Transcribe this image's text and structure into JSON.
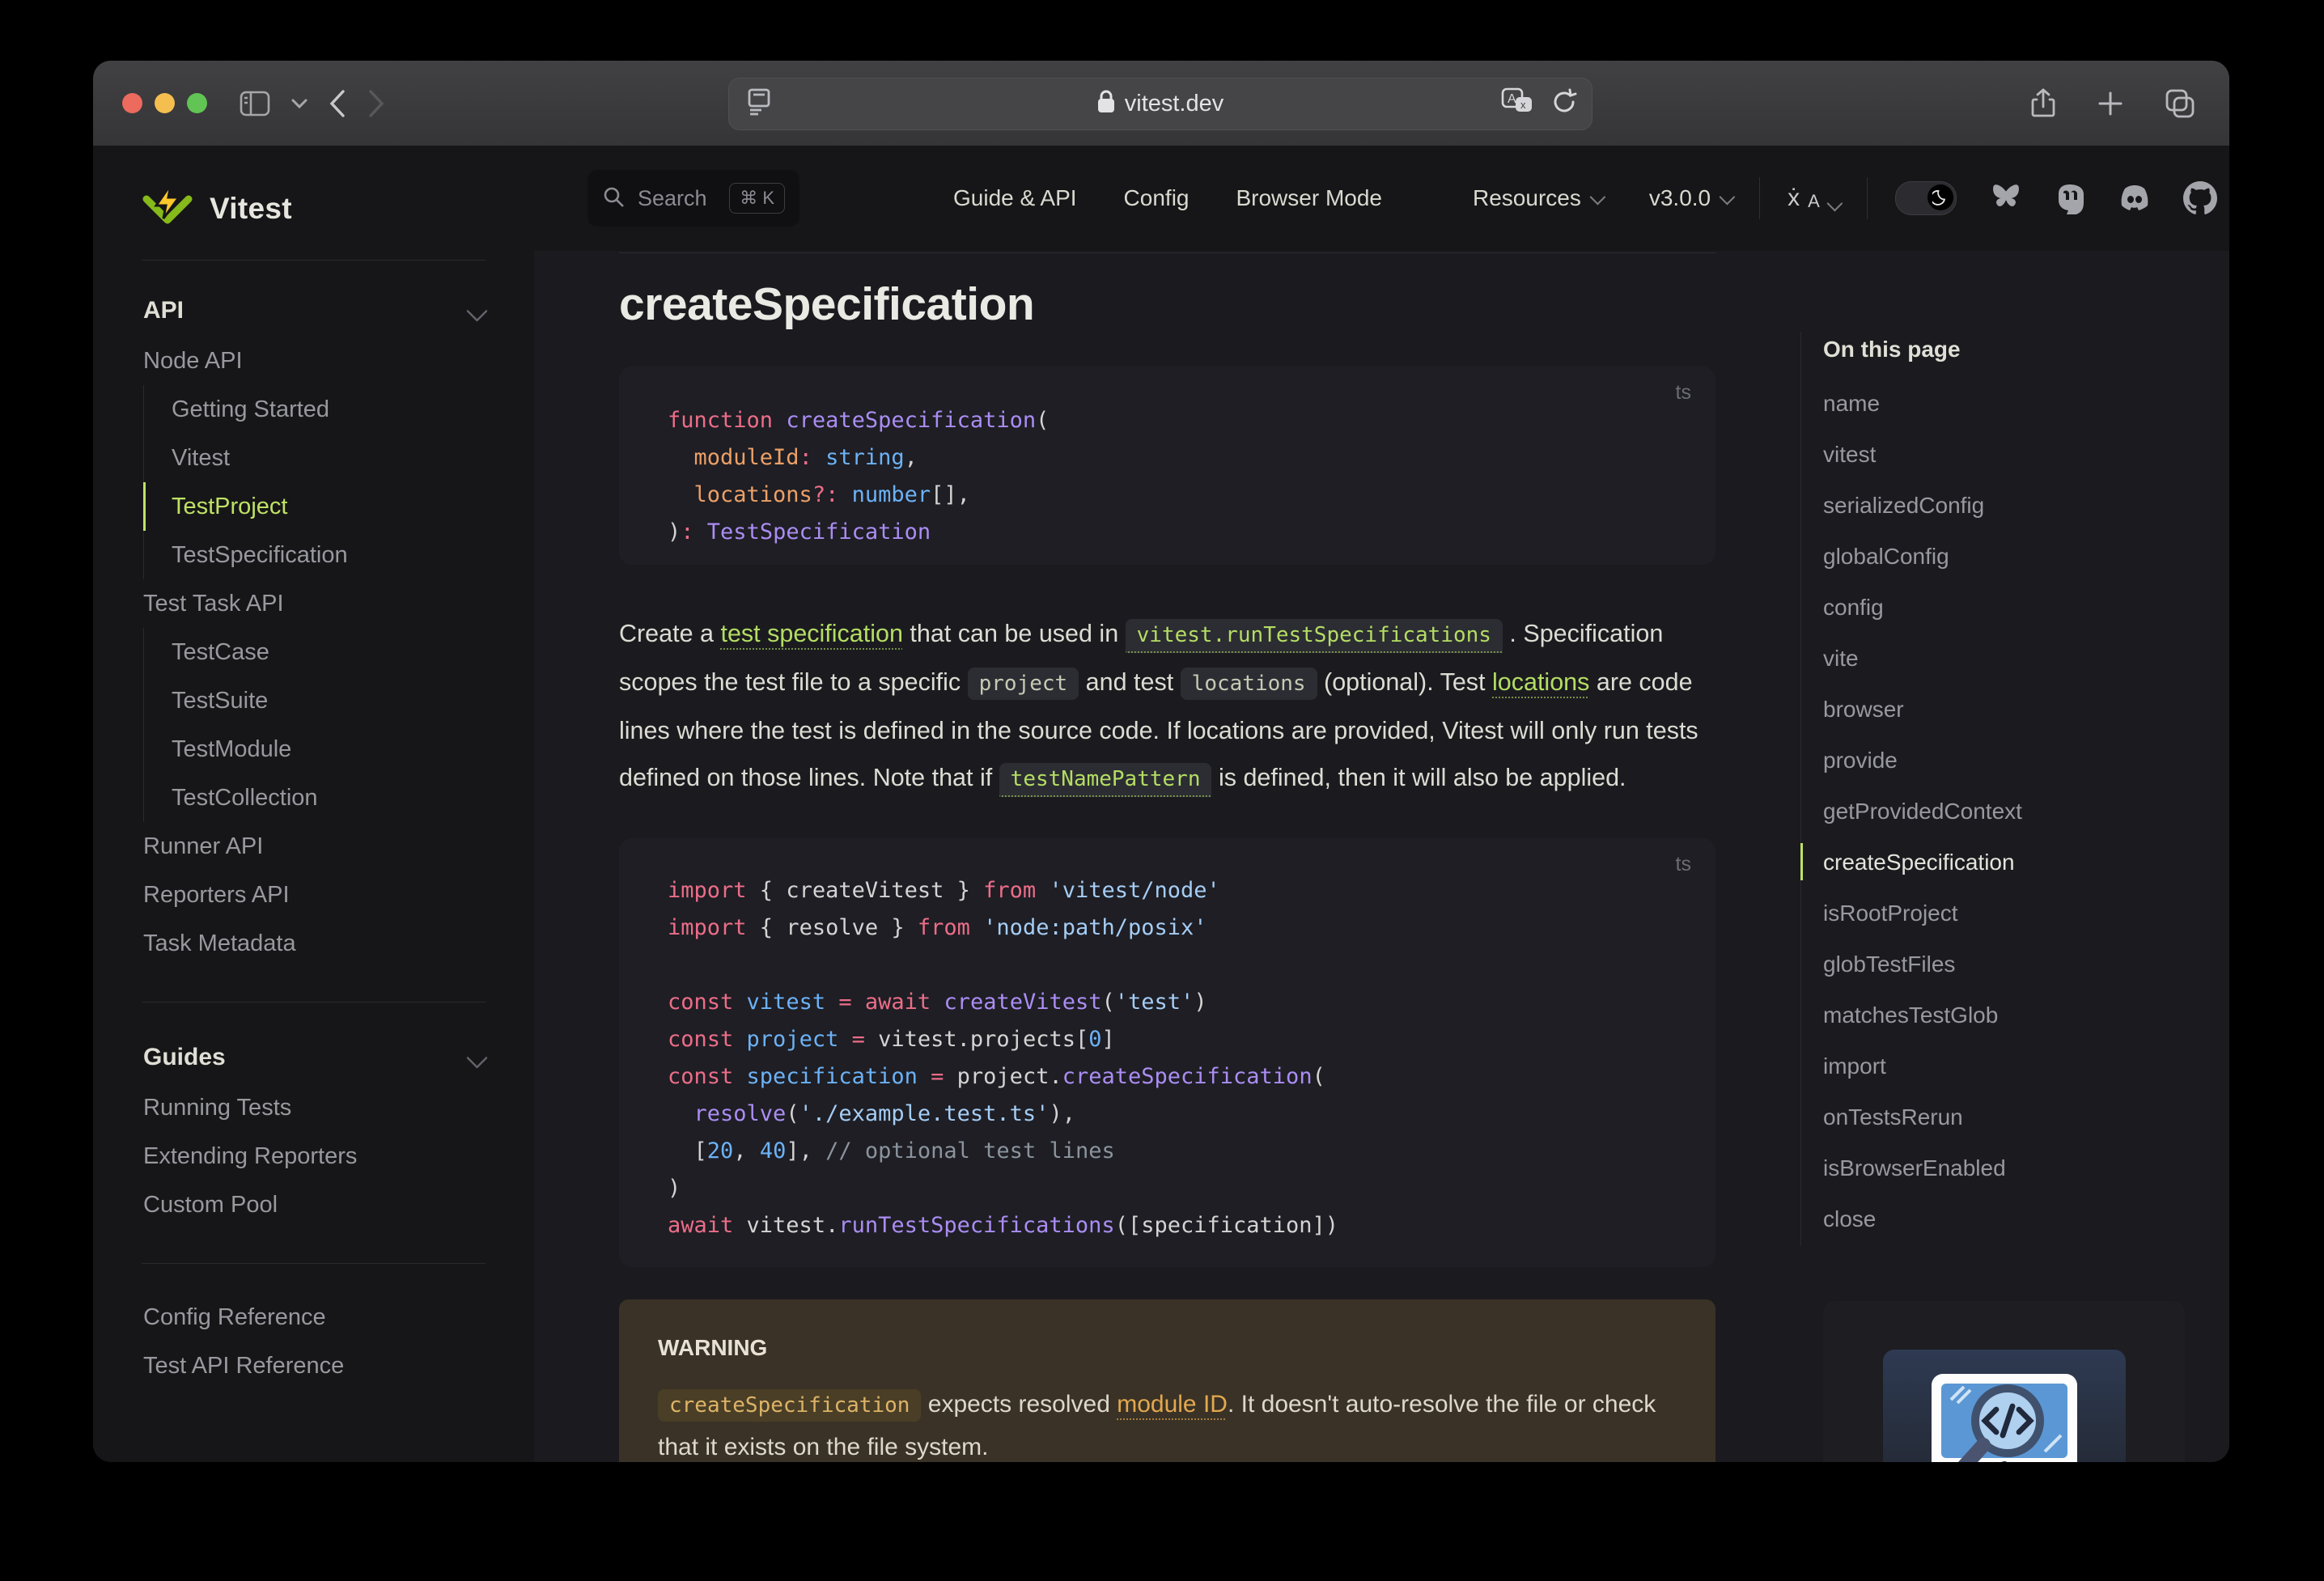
{
  "browser": {
    "url": "vitest.dev",
    "traffic_lights": [
      "#ec6a5e",
      "#f4bf4f",
      "#61c454"
    ]
  },
  "navbar": {
    "search": {
      "label": "Search",
      "shortcut": "⌘ K"
    },
    "links": [
      "Guide & API",
      "Config",
      "Browser Mode"
    ],
    "resources": "Resources",
    "version": "v3.0.0"
  },
  "sidebar": {
    "brand": "Vitest",
    "groups": [
      {
        "header": "API",
        "divider_above": false,
        "items": [
          {
            "label": "Node API",
            "indent": 0,
            "active": false
          },
          {
            "label": "Getting Started",
            "indent": 1,
            "active": false
          },
          {
            "label": "Vitest",
            "indent": 1,
            "active": false
          },
          {
            "label": "TestProject",
            "indent": 1,
            "active": true
          },
          {
            "label": "TestSpecification",
            "indent": 1,
            "active": false
          },
          {
            "label": "Test Task API",
            "indent": 0,
            "active": false
          },
          {
            "label": "TestCase",
            "indent": 1,
            "active": false
          },
          {
            "label": "TestSuite",
            "indent": 1,
            "active": false
          },
          {
            "label": "TestModule",
            "indent": 1,
            "active": false
          },
          {
            "label": "TestCollection",
            "indent": 1,
            "active": false
          },
          {
            "label": "Runner API",
            "indent": 0,
            "active": false
          },
          {
            "label": "Reporters API",
            "indent": 0,
            "active": false
          },
          {
            "label": "Task Metadata",
            "indent": 0,
            "active": false
          }
        ]
      },
      {
        "header": "Guides",
        "divider_above": true,
        "items": [
          {
            "label": "Running Tests",
            "indent": 0,
            "active": false
          },
          {
            "label": "Extending Reporters",
            "indent": 0,
            "active": false
          },
          {
            "label": "Custom Pool",
            "indent": 0,
            "active": false
          }
        ]
      },
      {
        "header": null,
        "divider_above": true,
        "items": [
          {
            "label": "Config Reference",
            "indent": 0,
            "active": false
          },
          {
            "label": "Test API Reference",
            "indent": 0,
            "active": false
          }
        ]
      }
    ]
  },
  "content": {
    "title": "createSpecification",
    "code_block_1": {
      "lang": "ts",
      "lines": [
        [
          {
            "c": "k",
            "t": "function "
          },
          {
            "c": "f",
            "t": "createSpecification"
          },
          {
            "c": "p",
            "t": "("
          }
        ],
        [
          {
            "c": "p",
            "t": "  "
          },
          {
            "c": "o",
            "t": "moduleId"
          },
          {
            "c": "k",
            "t": ":"
          },
          {
            "c": "p",
            "t": " "
          },
          {
            "c": "b",
            "t": "string"
          },
          {
            "c": "p",
            "t": ","
          }
        ],
        [
          {
            "c": "p",
            "t": "  "
          },
          {
            "c": "o",
            "t": "locations"
          },
          {
            "c": "k",
            "t": "?:"
          },
          {
            "c": "p",
            "t": " "
          },
          {
            "c": "b",
            "t": "number"
          },
          {
            "c": "p",
            "t": "[],"
          }
        ],
        [
          {
            "c": "p",
            "t": ")"
          },
          {
            "c": "k",
            "t": ":"
          },
          {
            "c": "p",
            "t": " "
          },
          {
            "c": "f",
            "t": "TestSpecification"
          }
        ]
      ]
    },
    "paragraph": [
      {
        "c": "text",
        "t": "Create a "
      },
      {
        "c": "link",
        "t": "test specification"
      },
      {
        "c": "text",
        "t": " that can be used in "
      },
      {
        "c": "codelink",
        "t": "vitest.runTestSpecifications"
      },
      {
        "c": "text",
        "t": " . Specification scopes the test file to a specific "
      },
      {
        "c": "code",
        "t": "project"
      },
      {
        "c": "text",
        "t": " and test "
      },
      {
        "c": "code",
        "t": "locations"
      },
      {
        "c": "text",
        "t": " (optional). Test "
      },
      {
        "c": "link",
        "t": "locations"
      },
      {
        "c": "text",
        "t": " are code lines where the test is defined in the source code. If locations are provided, Vitest will only run tests defined on those lines. Note that if "
      },
      {
        "c": "codelink",
        "t": "testNamePattern"
      },
      {
        "c": "text",
        "t": " is defined, then it will also be applied."
      }
    ],
    "code_block_2": {
      "lang": "ts",
      "lines": [
        [
          {
            "c": "k",
            "t": "import"
          },
          {
            "c": "p",
            "t": " { createVitest } "
          },
          {
            "c": "k",
            "t": "from"
          },
          {
            "c": "p",
            "t": " "
          },
          {
            "c": "s",
            "t": "'vitest/node'"
          }
        ],
        [
          {
            "c": "k",
            "t": "import"
          },
          {
            "c": "p",
            "t": " { resolve } "
          },
          {
            "c": "k",
            "t": "from"
          },
          {
            "c": "p",
            "t": " "
          },
          {
            "c": "s",
            "t": "'node:path/posix'"
          }
        ],
        [],
        [
          {
            "c": "k",
            "t": "const"
          },
          {
            "c": "p",
            "t": " "
          },
          {
            "c": "v",
            "t": "vitest"
          },
          {
            "c": "p",
            "t": " "
          },
          {
            "c": "k",
            "t": "="
          },
          {
            "c": "p",
            "t": " "
          },
          {
            "c": "k",
            "t": "await"
          },
          {
            "c": "p",
            "t": " "
          },
          {
            "c": "f",
            "t": "createVitest"
          },
          {
            "c": "p",
            "t": "("
          },
          {
            "c": "s",
            "t": "'test'"
          },
          {
            "c": "p",
            "t": ")"
          }
        ],
        [
          {
            "c": "k",
            "t": "const"
          },
          {
            "c": "p",
            "t": " "
          },
          {
            "c": "v",
            "t": "project"
          },
          {
            "c": "p",
            "t": " "
          },
          {
            "c": "k",
            "t": "="
          },
          {
            "c": "p",
            "t": " vitest.projects["
          },
          {
            "c": "n",
            "t": "0"
          },
          {
            "c": "p",
            "t": "]"
          }
        ],
        [
          {
            "c": "k",
            "t": "const"
          },
          {
            "c": "p",
            "t": " "
          },
          {
            "c": "v",
            "t": "specification"
          },
          {
            "c": "p",
            "t": " "
          },
          {
            "c": "k",
            "t": "="
          },
          {
            "c": "p",
            "t": " project."
          },
          {
            "c": "f",
            "t": "createSpecification"
          },
          {
            "c": "p",
            "t": "("
          }
        ],
        [
          {
            "c": "p",
            "t": "  "
          },
          {
            "c": "f",
            "t": "resolve"
          },
          {
            "c": "p",
            "t": "("
          },
          {
            "c": "s",
            "t": "'./example.test.ts'"
          },
          {
            "c": "p",
            "t": "),"
          }
        ],
        [
          {
            "c": "p",
            "t": "  ["
          },
          {
            "c": "n",
            "t": "20"
          },
          {
            "c": "p",
            "t": ", "
          },
          {
            "c": "n",
            "t": "40"
          },
          {
            "c": "p",
            "t": "], "
          },
          {
            "c": "c",
            "t": "// optional test lines"
          }
        ],
        [
          {
            "c": "p",
            "t": ")"
          }
        ],
        [
          {
            "c": "k",
            "t": "await"
          },
          {
            "c": "p",
            "t": " vitest."
          },
          {
            "c": "f",
            "t": "runTestSpecifications"
          },
          {
            "c": "p",
            "t": "([specification])"
          }
        ]
      ]
    },
    "warning": {
      "title": "WARNING",
      "body": [
        {
          "c": "codewarn",
          "t": "createSpecification"
        },
        {
          "c": "text",
          "t": " expects resolved "
        },
        {
          "c": "warnlink",
          "t": "module ID"
        },
        {
          "c": "text",
          "t": ". It doesn't auto-resolve the file or check that it exists on the file system."
        }
      ]
    }
  },
  "aside": {
    "title": "On this page",
    "items": [
      "name",
      "vitest",
      "serializedConfig",
      "globalConfig",
      "config",
      "vite",
      "browser",
      "provide",
      "getProvidedContext",
      "createSpecification",
      "isRootProject",
      "globTestFiles",
      "matchesTestGlob",
      "import",
      "onTestsRerun",
      "isBrowserEnabled",
      "close"
    ],
    "active_index": 9
  },
  "colors": {
    "accent_green": "#bfe264",
    "logo_yellow": "#fcc72b",
    "logo_green": "#86b91a"
  }
}
